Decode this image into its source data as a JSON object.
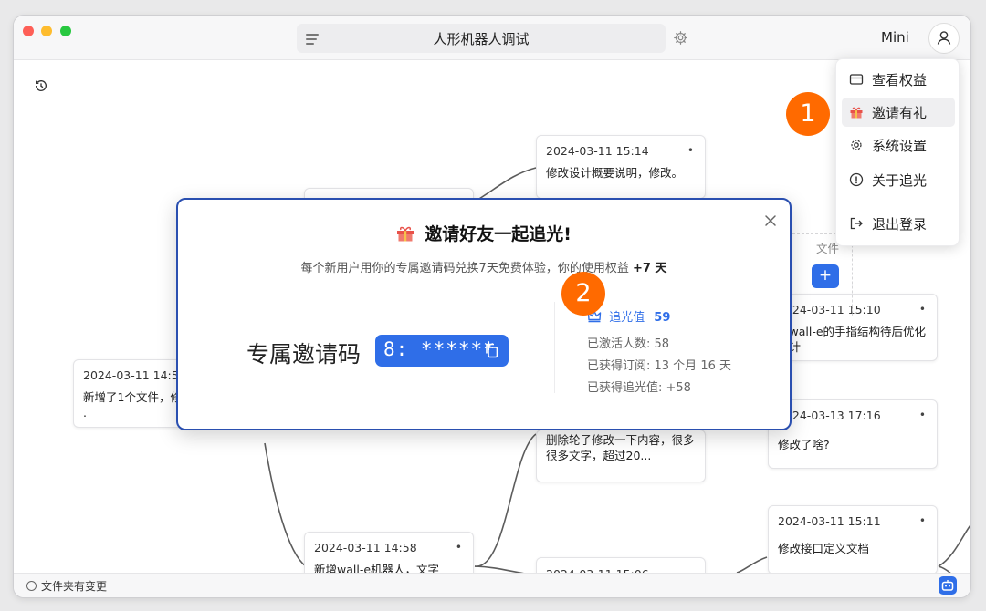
{
  "window": {
    "title": "人形机器人调试",
    "plan_label": "Mini"
  },
  "menu": {
    "items": [
      {
        "label": "查看权益",
        "icon": "card-icon"
      },
      {
        "label": "邀请有礼",
        "icon": "gift-icon"
      },
      {
        "label": "系统设置",
        "icon": "gear-icon"
      },
      {
        "label": "关于追光",
        "icon": "info-icon"
      },
      {
        "label": "退出登录",
        "icon": "logout-icon"
      }
    ]
  },
  "markers": {
    "one": "1",
    "two": "2"
  },
  "cards": [
    {
      "date": "2024-03-11 15:14",
      "text": "修改设计概要说明，修改。"
    },
    {
      "date": "2024-03-11 14:5",
      "text": "新增了1个文件，修r ."
    },
    {
      "date": "2024-03-11 15:10",
      "text": "除wall-e的手指结构待后优化设计"
    },
    {
      "date": "2024-03-13 17:16",
      "text": "修改了啥?"
    },
    {
      "date": "",
      "text": "删除轮子修改一下内容，很多很多文字，超过20..."
    },
    {
      "date": "2024-03-11 15:11",
      "text": "修改接口定义文档"
    },
    {
      "date": "2024-03-11 14:58",
      "text": "新增wall-e机器人，文字"
    },
    {
      "date": "2024-03-11 15:06",
      "text": ""
    }
  ],
  "peek": {
    "text": "文件",
    "add": "+"
  },
  "modal": {
    "title": "邀请好友一起追光!",
    "subtitle_prefix": "每个新用户用你的专属邀请码兑换7天免费体验，你的使用权益",
    "subtitle_bonus": "+7 天",
    "code_label": "专属邀请码",
    "code_value": "8: ******",
    "stats": {
      "points_label": "追光值",
      "points_value": "59",
      "activated": "已激活人数: 58",
      "subscription": "已获得订阅: 13 个月 16 天",
      "earned_points": "已获得追光值: +58"
    }
  },
  "status": {
    "text": "文件夹有变更"
  },
  "colors": {
    "accent": "#2f6ee8",
    "marker": "#ff6a00",
    "modal_border": "#2a4fb0"
  }
}
